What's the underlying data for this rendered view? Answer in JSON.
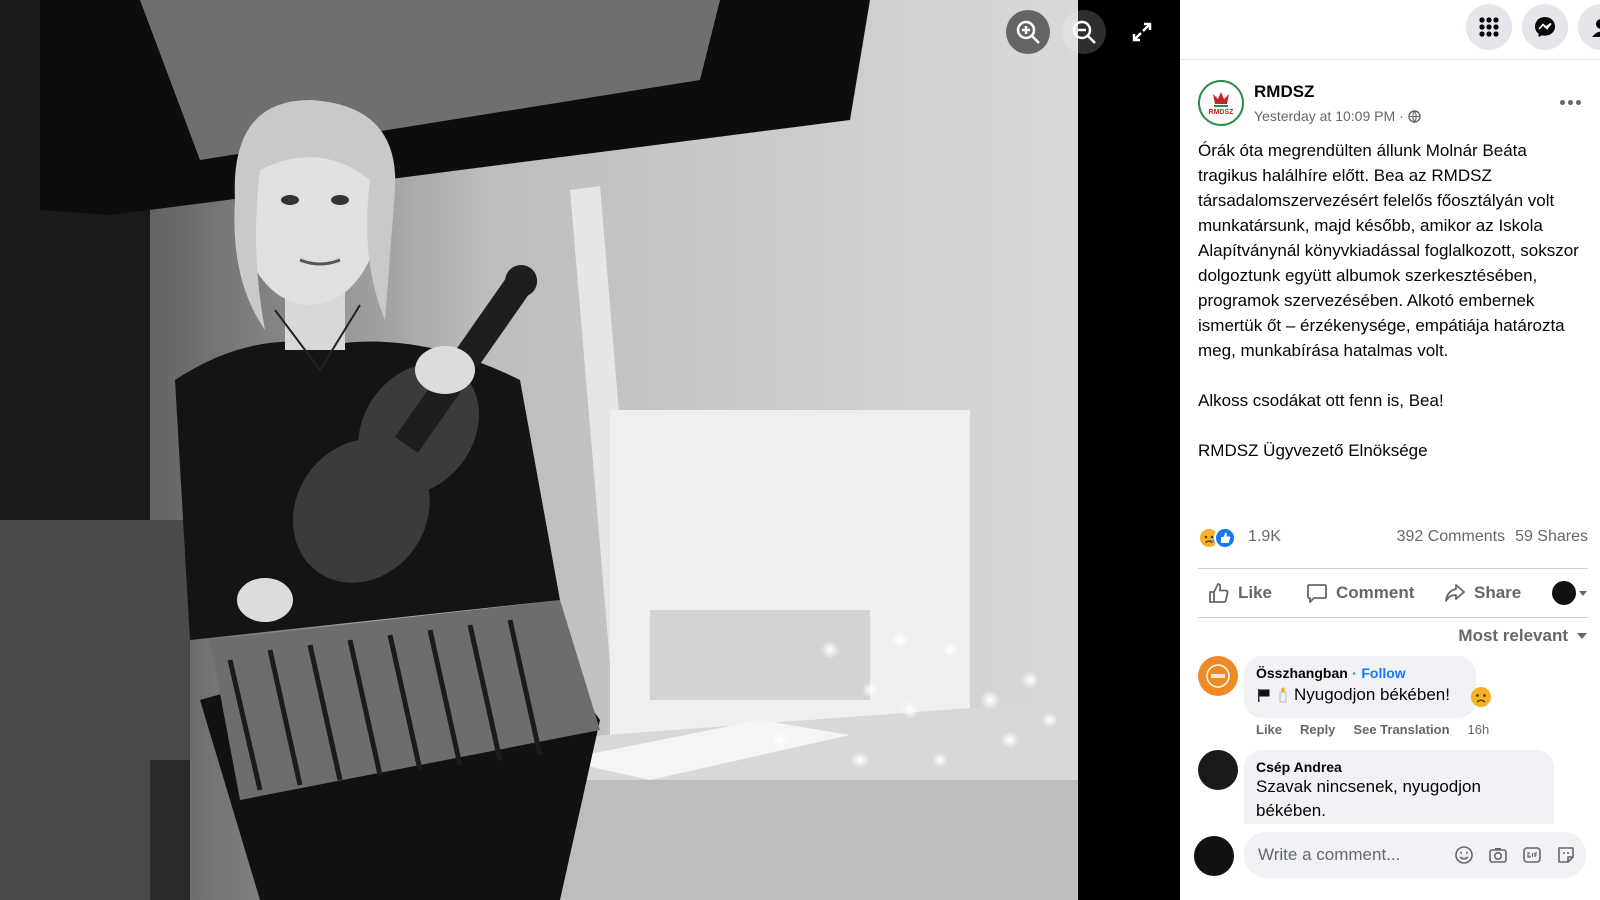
{
  "post": {
    "page_name": "RMDSZ",
    "avatar_logo_text": "RMDSZ",
    "timestamp": "Yesterday at 10:09 PM",
    "separator": "·",
    "paragraphs": [
      "Órák óta megrendülten állunk Molnár Beáta tragikus halálhíre előtt. Bea az RMDSZ társadalomszervezésért felelős főosztályán volt munkatársunk, majd később, amikor az Iskola Alapítványnál könyvkiadással foglalkozott, sokszor dolgoztunk együtt albumok szerkesztésében, programok szervezésében. Alkotó embernek ismertük őt – érzékenysége, empátiája határozta meg, munkabírása hatalmas volt.",
      "Alkoss csodákat ott fenn is, Bea!",
      "RMDSZ Ügyvezető Elnöksége"
    ]
  },
  "stats": {
    "reactions": "1.9K",
    "comments": "392 Comments",
    "shares": "59 Shares"
  },
  "actions": {
    "like": "Like",
    "comment": "Comment",
    "share": "Share"
  },
  "sort_label": "Most relevant",
  "comments": [
    {
      "author": "Összhangban",
      "follow": "Follow",
      "follow_sep": "·",
      "text": "Nyugodjon békében!",
      "like": "Like",
      "reply": "Reply",
      "translate": "See Translation",
      "time": "16h"
    },
    {
      "author": "Csép Andrea",
      "text": "Szavak nincsenek, nyugodjon békében."
    }
  ],
  "composer": {
    "placeholder": "Write a comment..."
  },
  "colors": {
    "brand_blue": "#1877f2",
    "panel_bg": "#ffffff",
    "bubble_bg": "#f0f2f5",
    "secondary_text": "#65676b"
  },
  "icons": {
    "zoom_in": "zoom-in-icon",
    "zoom_out": "zoom-out-icon",
    "fullscreen": "fullscreen-icon",
    "menu": "grid-menu-icon",
    "messenger": "messenger-icon",
    "globe": "globe-icon"
  }
}
